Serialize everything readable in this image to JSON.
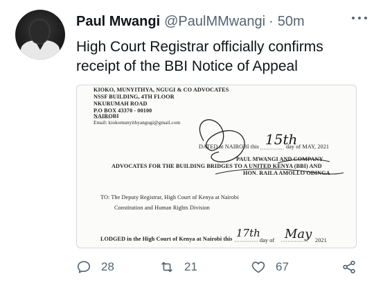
{
  "tweet": {
    "author_name": "Paul Mwangi",
    "handle": "@PaulMMwangi",
    "separator": "·",
    "time": "50m",
    "text": "High Court Registrar officially confirms receipt of the BBI Notice of Appeal"
  },
  "document": {
    "line1": "KIOKO, MUNYITHYA, NGUGI & CO ADVOCATES",
    "line2": "NSSF BUILDING, 4TH FLOOR",
    "line3": "NKURUMAH ROAD",
    "line4": "P.O BOX 43370 - 00100",
    "line5": "NAIROBI",
    "email": "Email: kiokomunyithyangugi@gmail.com",
    "dated": "DATED at NAIROBI this",
    "dated_day": "15th",
    "dated_rest": "day of MAY, 2021",
    "paul_line": "PAUL MWANGI AND COMPANY",
    "advocates_line": "ADVOCATES FOR THE BUILDING BRIDGES TO A UNITED KENYA (BBI) AND",
    "hon_line": "HON. RAILA AMOLLO ODINGA",
    "to_line": "TO: The Deputy Registrar, High Court of Kenya at Nairobi",
    "division_line": "Constitution and Human Rights Division",
    "lodged": "LODGED in the High Court of Kenya at Nairobi this",
    "lodged_day": "17th",
    "lodged_mid": "day of",
    "lodged_month": "May",
    "lodged_year": "2021"
  },
  "actions": {
    "replies": "28",
    "retweets": "21",
    "likes": "67"
  },
  "colors": {
    "text": "#0f1419",
    "secondary": "#536471",
    "border": "#cfd9de"
  }
}
